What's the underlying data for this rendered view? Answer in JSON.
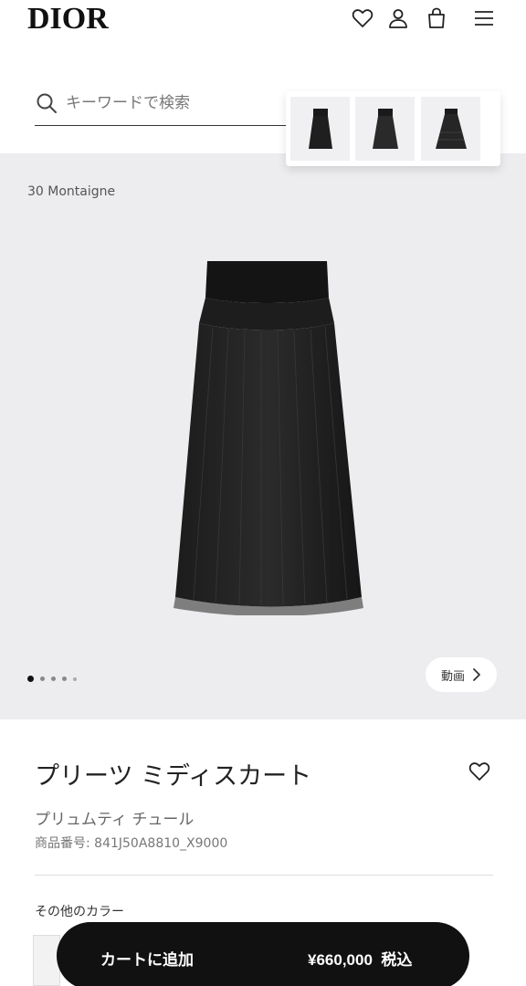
{
  "header": {
    "logo": "DIOR",
    "icons": [
      "heart-icon",
      "user-icon",
      "bag-icon",
      "menu-icon"
    ]
  },
  "search": {
    "placeholder": "キーワードで検索",
    "value": ""
  },
  "thumbnails": {
    "count": 3
  },
  "hero": {
    "collection": "30 Montaigne",
    "slide_count": 5,
    "active_slide": 1,
    "video_label": "動画"
  },
  "product": {
    "title": "プリーツ ミディスカート",
    "subtitle": "プリュムティ チュール",
    "sku": "商品番号: 841J50A8810_X9000",
    "colors_label": "その他のカラー"
  },
  "cart": {
    "label": "カートに追加",
    "price": "¥660,000",
    "tax": "税込"
  },
  "colors": {
    "background": "#ffffff",
    "hero_bg": "#ededf0",
    "cart_bg": "#111111",
    "text": "#222222"
  }
}
